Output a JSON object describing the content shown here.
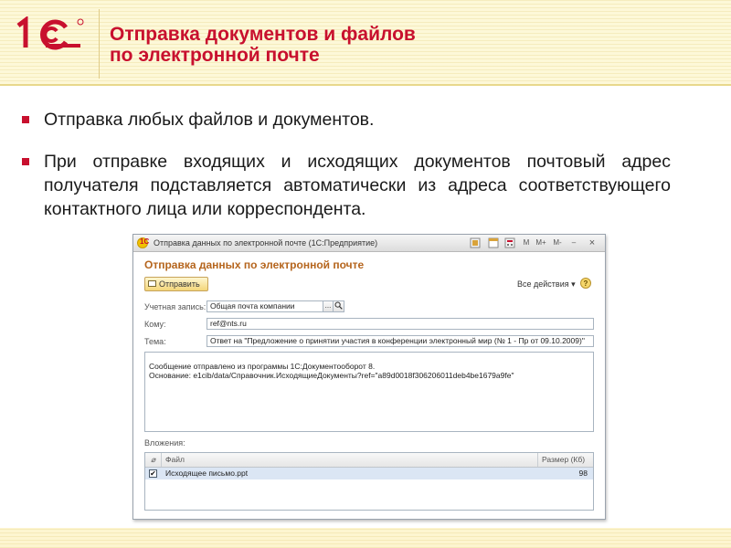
{
  "slide": {
    "title_line1": "Отправка документов и файлов",
    "title_line2": "по электронной почте",
    "bullets": [
      "Отправка любых файлов и документов.",
      "При отправке входящих и исходящих документов почтовый адрес получателя подставляется автоматически из адреса соответствующего контактного лица или корреспондента."
    ]
  },
  "window": {
    "title": "Отправка данных по электронной почте  (1С:Предприятие)",
    "toolbar": {
      "m": "M",
      "m_plus": "M+",
      "m_minus": "M-",
      "minimize": "–",
      "close": "×"
    },
    "form_title": "Отправка данных по электронной почте",
    "send_label": "Отправить",
    "all_actions_label": "Все действия",
    "help_label": "?",
    "account": {
      "label": "Учетная запись:",
      "value": "Общая почта компании",
      "more_label": "...",
      "search_icon": "search-icon"
    },
    "to": {
      "label": "Кому:",
      "value": "ref@nts.ru"
    },
    "subject": {
      "label": "Тема:",
      "value": "Ответ на \"Предложение о принятии участия в конференции электронный мир (№ 1 - Пр от 09.10.2009)\""
    },
    "body": {
      "line1": "Сообщение отправлено из программы 1С:Документооборот 8.",
      "line2": "Основание: e1cib/data/Справочник.ИсходящиеДокументы?ref=\"a89d0018f306206011deb4be1679a9fe\""
    },
    "attachments": {
      "label": "Вложения:",
      "headers": {
        "file": "Файл",
        "size": "Размер (Кб)"
      },
      "rows": [
        {
          "checked": "✔",
          "file": "Исходящее письмо.ppt",
          "size": "98"
        }
      ]
    }
  },
  "colors": {
    "accent": "#c8102e",
    "form_title": "#b5651d",
    "header_bg": "#fdf8d8"
  }
}
